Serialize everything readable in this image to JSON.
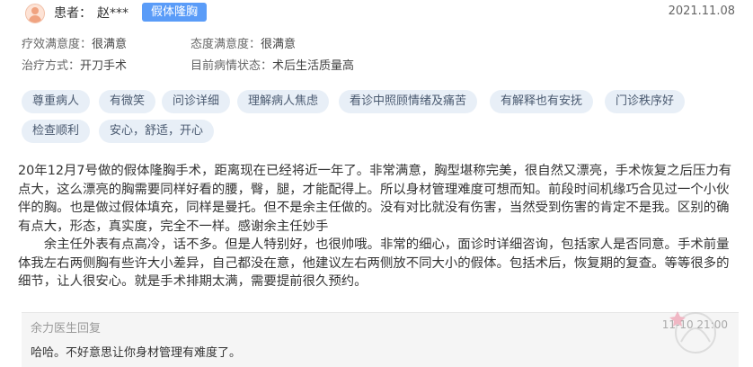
{
  "header": {
    "patient_label": "患者：",
    "patient_name": "赵***",
    "procedure_tag": "假体隆胸",
    "date": "2021.11.08"
  },
  "info": {
    "efficacy_label": "疗效满意度：",
    "efficacy_value": "很满意",
    "attitude_label": "态度满意度：",
    "attitude_value": "很满意",
    "method_label": "治疗方式：",
    "method_value": "开刀手术",
    "status_label": "目前病情状态：",
    "status_value": "术后生活质量高"
  },
  "tags": [
    "尊重病人",
    "有微笑",
    "问诊详细",
    "理解病人焦虑",
    "看诊中照顾情绪及痛苦",
    "有解释也有安抚",
    "门诊秩序好",
    "检查顺利",
    "安心，舒适，开心"
  ],
  "review": {
    "paragraph1": "20年12月7号做的假体隆胸手术，距离现在已经将近一年了。非常满意，胸型堪称完美，很自然又漂亮，手术恢复之后压力有点大，这么漂亮的胸需要同样好看的腰，臀，腿，才能配得上。所以身材管理难度可想而知。前段时间机缘巧合见过一个小伙伴的胸。也是做过假体填充，同样是曼托。但不是余主任做的。没有对比就没有伤害，当然受到伤害的肯定不是我。区别的确有点大，形态，真实度，完全不一样。感谢余主任妙手",
    "paragraph2": "余主任外表有点高冷，话不多。但是人特别好，也很帅哦。非常的细心，面诊时详细咨询，包括家人是否同意。手术前量体我左右两侧胸有些许大小差异，自己都没在意，他建议左右两侧放不同大小的假体。包括术后，恢复期的复查。等等很多的细节，让人很安心。就是手术排期太满，需要提前很久预约。"
  },
  "reply": {
    "title": "余力医生回复",
    "time": "11-10 21:00",
    "text": "哈哈。不好意思让你身材管理有难度了。"
  },
  "colors": {
    "tag_blue": "#5a9cf8",
    "chip_bg": "#e8eff7",
    "reply_bg": "#f5f5f5"
  }
}
